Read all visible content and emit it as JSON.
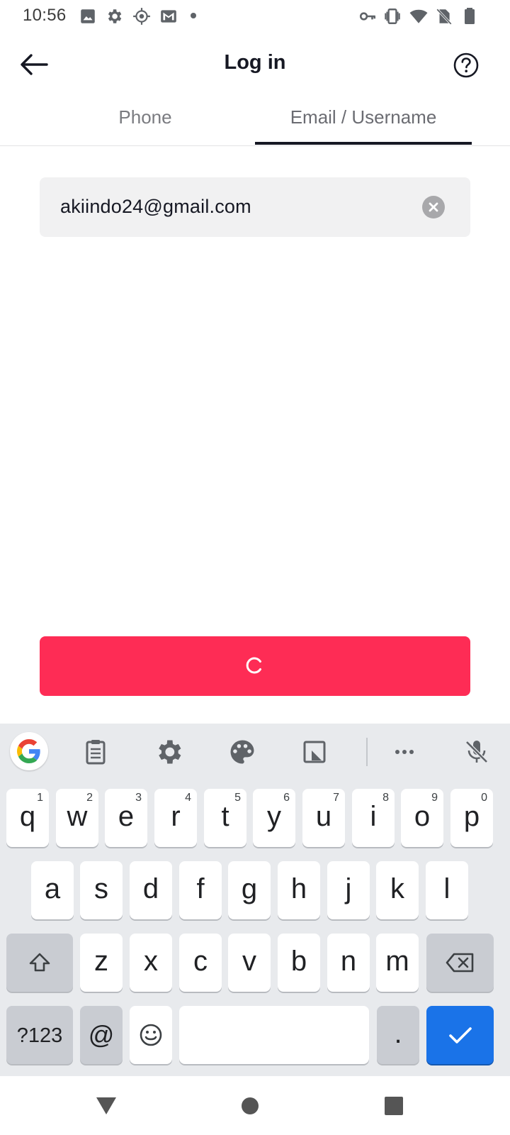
{
  "status_bar": {
    "time": "10:56",
    "left_icons": [
      "image-icon",
      "settings-icon",
      "location-icon",
      "gmail-icon",
      "dot-icon"
    ],
    "right_icons": [
      "vpn-key-icon",
      "vibrate-icon",
      "wifi-icon",
      "no-sim-icon",
      "battery-icon"
    ]
  },
  "header": {
    "title": "Log in",
    "back_icon": "arrow-left-icon",
    "help_icon": "help-circle-icon"
  },
  "tabs": [
    {
      "label": "Phone",
      "active": false
    },
    {
      "label": "Email / Username",
      "active": true
    }
  ],
  "email_input": {
    "value": "akiindo24@gmail.com",
    "clear_icon": "clear-icon"
  },
  "submit_button": {
    "state": "loading",
    "icon": "spinner-icon",
    "color": "#fe2c55"
  },
  "keyboard": {
    "toolbar": [
      "google-icon",
      "clipboard-icon",
      "settings-icon",
      "palette-icon",
      "floating-keyboard-icon",
      "more-icon",
      "mic-off-icon"
    ],
    "row1": [
      {
        "key": "q",
        "hint": "1"
      },
      {
        "key": "w",
        "hint": "2"
      },
      {
        "key": "e",
        "hint": "3"
      },
      {
        "key": "r",
        "hint": "4"
      },
      {
        "key": "t",
        "hint": "5"
      },
      {
        "key": "y",
        "hint": "6"
      },
      {
        "key": "u",
        "hint": "7"
      },
      {
        "key": "i",
        "hint": "8"
      },
      {
        "key": "o",
        "hint": "9"
      },
      {
        "key": "p",
        "hint": "0"
      }
    ],
    "row2": [
      "a",
      "s",
      "d",
      "f",
      "g",
      "h",
      "j",
      "k",
      "l"
    ],
    "row3": [
      "z",
      "x",
      "c",
      "v",
      "b",
      "n",
      "m"
    ],
    "row4": {
      "symbols": "?123",
      "at": "@",
      "period": ".",
      "enter_color": "#1a73e8"
    }
  },
  "nav_bar": [
    "back-triangle-icon",
    "home-circle-icon",
    "recents-square-icon"
  ]
}
